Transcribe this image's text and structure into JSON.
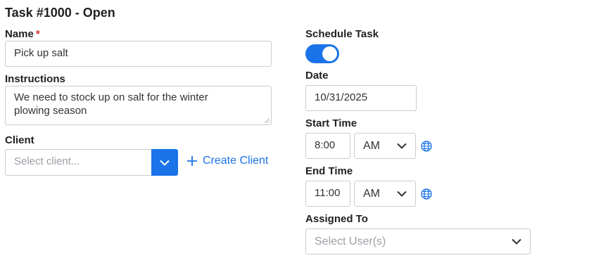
{
  "header": {
    "title": "Task #1000 - Open"
  },
  "name_field": {
    "label": "Name",
    "required_mark": "*",
    "value": "Pick up salt"
  },
  "instructions_field": {
    "label": "Instructions",
    "value": "We need to stock up on salt for the winter plowing season"
  },
  "client_field": {
    "label": "Client",
    "placeholder": "Select client...",
    "create_label": "Create Client"
  },
  "schedule": {
    "label": "Schedule Task",
    "enabled": true
  },
  "date_field": {
    "label": "Date",
    "value": "10/31/2025"
  },
  "start_time": {
    "label": "Start Time",
    "time": "8:00",
    "period": "AM"
  },
  "end_time": {
    "label": "End Time",
    "time": "11:00",
    "period": "AM"
  },
  "assigned_to": {
    "label": "Assigned To",
    "placeholder": "Select User(s)"
  },
  "colors": {
    "accent": "#1a73e8",
    "required": "#d32f2f",
    "border": "#c9ccd1"
  },
  "icons": [
    "chevron-down-icon",
    "plus-icon",
    "globe-icon"
  ]
}
